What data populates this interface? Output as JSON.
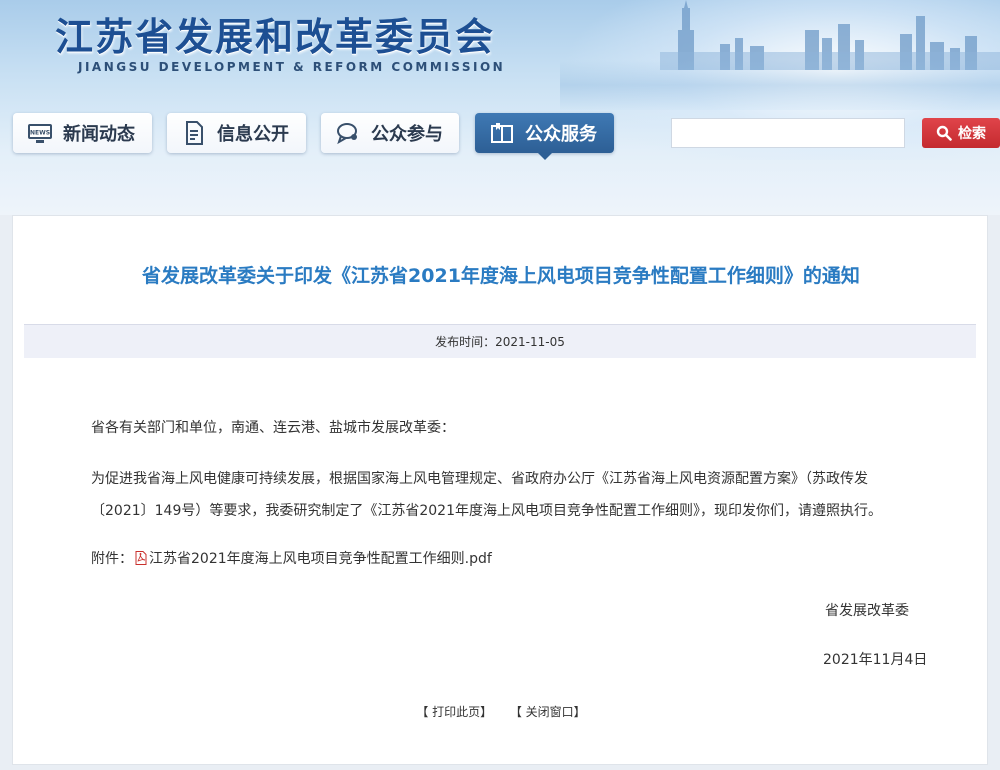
{
  "header": {
    "title_cn": "江苏省发展和改革委员会",
    "title_en": "JIANGSU DEVELOPMENT & REFORM COMMISSION"
  },
  "nav": {
    "items": [
      {
        "label": "新闻动态",
        "icon": "news-icon",
        "active": false
      },
      {
        "label": "信息公开",
        "icon": "document-icon",
        "active": false
      },
      {
        "label": "公众参与",
        "icon": "chat-bubble-icon",
        "active": false
      },
      {
        "label": "公众服务",
        "icon": "book-icon",
        "active": true
      }
    ]
  },
  "search": {
    "value": "",
    "button_label": "检索"
  },
  "article": {
    "title": "省发展改革委关于印发《江苏省2021年度海上风电项目竞争性配置工作细则》的通知",
    "publish_label": "发布时间：2021-11-05",
    "salutation": "省各有关部门和单位，南通、连云港、盐城市发展改革委：",
    "body": "为促进我省海上风电健康可持续发展，根据国家海上风电管理规定、省政府办公厅《江苏省海上风电资源配置方案》（苏政传发〔2021〕149号）等要求，我委研究制定了《江苏省2021年度海上风电项目竞争性配置工作细则》，现印发你们，请遵照执行。",
    "attachment_label": "附件：",
    "attachment_name": "江苏省2021年度海上风电项目竞争性配置工作细则.pdf",
    "signer": "省发展改革委",
    "date": "2021年11月4日"
  },
  "footer": {
    "print_label": "【 打印此页】",
    "close_label": "【 关闭窗口】"
  },
  "colors": {
    "title_blue": "#2a7bc2",
    "brand_blue": "#1d4f93",
    "nav_active": "#2d5f95",
    "search_red": "#c42a2f"
  }
}
